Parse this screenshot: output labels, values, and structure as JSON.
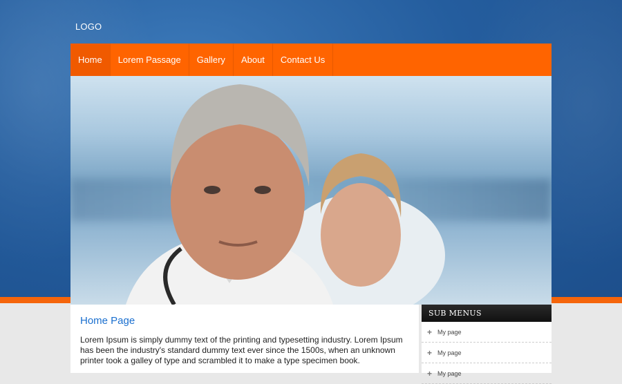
{
  "header": {
    "logo": "LOGO"
  },
  "nav": {
    "items": [
      {
        "label": "Home"
      },
      {
        "label": "Lorem Passage"
      },
      {
        "label": "Gallery"
      },
      {
        "label": "About"
      },
      {
        "label": "Contact Us"
      }
    ]
  },
  "main": {
    "title": "Home Page",
    "text": "Lorem Ipsum is simply dummy text of the printing and typesetting industry. Lorem Ipsum has been the industry's standard dummy text ever since the 1500s, when an unknown printer took a galley of type and scrambled it to make a type specimen book."
  },
  "sidebar": {
    "heading": "SUB MENUS",
    "items": [
      {
        "label": "My page"
      },
      {
        "label": "My page"
      },
      {
        "label": "My page"
      }
    ]
  },
  "colors": {
    "accent": "#ff6400",
    "background": "#245d9e",
    "link": "#1a6fcf"
  }
}
